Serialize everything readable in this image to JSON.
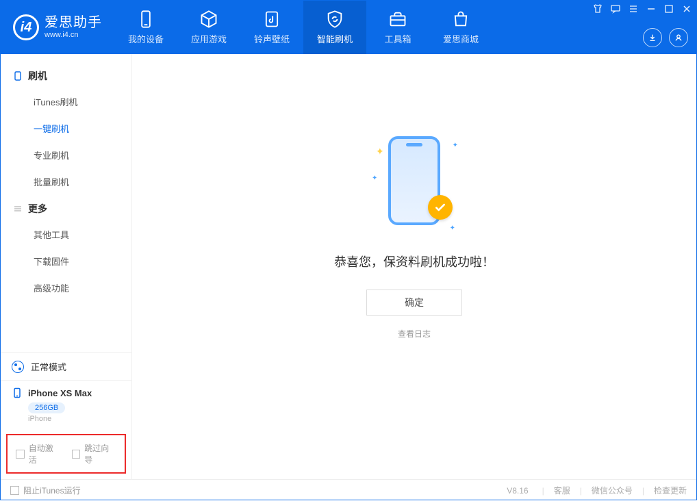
{
  "app": {
    "name_cn": "爱思助手",
    "url": "www.i4.cn"
  },
  "tabs": {
    "device": "我的设备",
    "apps": "应用游戏",
    "ringtone": "铃声壁纸",
    "flash": "智能刷机",
    "toolbox": "工具箱",
    "store": "爱思商城"
  },
  "sidebar": {
    "group1": {
      "title": "刷机",
      "items": [
        "iTunes刷机",
        "一键刷机",
        "专业刷机",
        "批量刷机"
      ]
    },
    "group2": {
      "title": "更多",
      "items": [
        "其他工具",
        "下载固件",
        "高级功能"
      ]
    },
    "mode": "正常模式",
    "device": {
      "name": "iPhone XS Max",
      "capacity": "256GB",
      "type": "iPhone"
    },
    "checks": {
      "auto_activate": "自动激活",
      "skip_guide": "跳过向导"
    }
  },
  "main": {
    "success": "恭喜您，保资料刷机成功啦！",
    "ok": "确定",
    "view_log": "查看日志"
  },
  "footer": {
    "block_itunes": "阻止iTunes运行",
    "version": "V8.16",
    "support": "客服",
    "wechat": "微信公众号",
    "update": "检查更新"
  }
}
